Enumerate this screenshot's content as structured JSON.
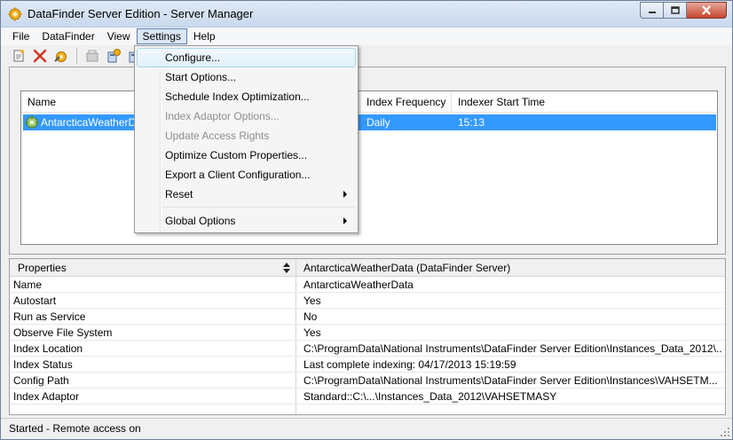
{
  "window": {
    "title": "DataFinder Server Edition - Server Manager"
  },
  "menubar": {
    "items": [
      "File",
      "DataFinder",
      "View",
      "Settings",
      "Help"
    ],
    "active": "Settings"
  },
  "toolbar": {
    "icons": [
      "new-server-icon",
      "delete-icon",
      "configure-icon",
      "disabled-server-icon",
      "start-server-icon",
      "stop-server-icon"
    ]
  },
  "server_list": {
    "columns": [
      "Name",
      "Index Frequency",
      "Indexer Start Time"
    ],
    "rows": [
      {
        "name": "AntarcticaWeatherD",
        "index_frequency": "Daily",
        "indexer_start_time": "15:13"
      }
    ]
  },
  "settings_menu": {
    "items": [
      {
        "label": "Configure...",
        "enabled": true,
        "submenu": false
      },
      {
        "label": "Start Options...",
        "enabled": true,
        "submenu": false
      },
      {
        "label": "Schedule Index Optimization...",
        "enabled": true,
        "submenu": false
      },
      {
        "label": "Index Adaptor Options...",
        "enabled": false,
        "submenu": false
      },
      {
        "label": "Update Access Rights",
        "enabled": false,
        "submenu": false
      },
      {
        "label": "Optimize Custom Properties...",
        "enabled": true,
        "submenu": false
      },
      {
        "label": "Export a Client Configuration...",
        "enabled": true,
        "submenu": false
      },
      {
        "label": "Reset",
        "enabled": true,
        "submenu": true
      },
      {
        "label": "Global Options",
        "enabled": true,
        "submenu": true
      }
    ]
  },
  "properties": {
    "header_name": "Properties",
    "header_value": "AntarcticaWeatherData (DataFinder Server)",
    "rows": [
      {
        "name": "Name",
        "value": "AntarcticaWeatherData"
      },
      {
        "name": "Autostart",
        "value": "Yes"
      },
      {
        "name": "Run as Service",
        "value": "No"
      },
      {
        "name": "Observe File System",
        "value": "Yes"
      },
      {
        "name": "Index Location",
        "value": "C:\\ProgramData\\National Instruments\\DataFinder Server Edition\\Instances_Data_2012\\..."
      },
      {
        "name": "Index Status",
        "value": "Last complete indexing: 04/17/2013   15:19:59"
      },
      {
        "name": "Config Path",
        "value": "C:\\ProgramData\\National Instruments\\DataFinder Server Edition\\Instances\\VAHSETM..."
      },
      {
        "name": "Index Adaptor",
        "value": "Standard::C:\\...\\Instances_Data_2012\\VAHSETMASY"
      }
    ]
  },
  "statusbar": {
    "text": "Started - Remote access on"
  },
  "colors": {
    "selection": "#3399ff",
    "menu_hover": "#e0f0fa",
    "titlebar": "#c9d9ee"
  }
}
